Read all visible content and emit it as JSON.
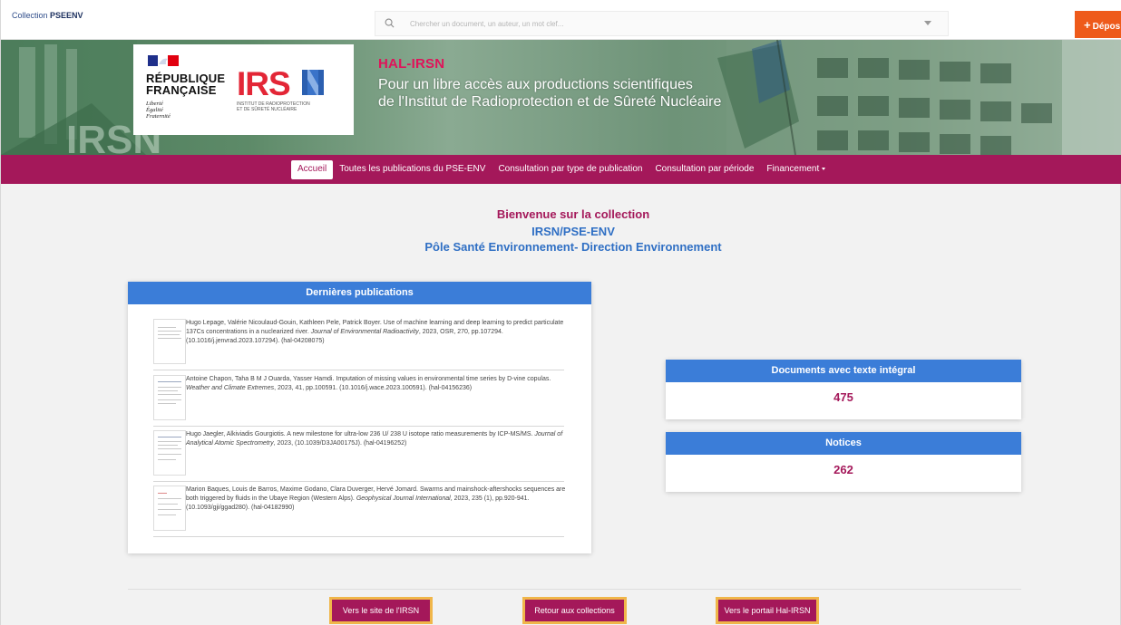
{
  "topbar": {
    "collection_prefix": "Collection",
    "collection_code": "PSEENV",
    "search_placeholder": "Chercher un document, un auteur, un mot clef...",
    "deposit_label": "Dépos"
  },
  "banner": {
    "republique_l1": "RÉPUBLIQUE",
    "republique_l2": "FRANÇAISE",
    "motto": "Liberté\nÉgalité\nFraternité",
    "irsn_logo": "IRSN",
    "irsn_subtitle": "INSTITUT DE RADIOPROTECTION\nET DE SÛRETÉ NUCLÉAIRE",
    "brand": "HAL-IRSN",
    "tagline_l1": "Pour un libre accès aux productions scientifiques",
    "tagline_l2": "de l'Institut de Radioprotection et de Sûreté Nucléaire"
  },
  "nav": {
    "items": [
      {
        "label": "Accueil",
        "active": true
      },
      {
        "label": "Toutes les publications du PSE-ENV"
      },
      {
        "label": "Consultation par type de publication"
      },
      {
        "label": "Consultation par période"
      },
      {
        "label": "Financement"
      }
    ]
  },
  "welcome": {
    "line1": "Bienvenue sur la collection",
    "line2": "IRSN/PSE-ENV",
    "line3": "Pôle Santé Environnement- Direction Environnement"
  },
  "publications": {
    "title": "Dernières publications",
    "items": [
      {
        "authors": "Hugo Lepage, Valérie Nicoulaud-Gouin, Kathleen Pele, Patrick Boyer.",
        "title": " Use of machine learning and deep learning to predict particulate 137Cs concentrations in a nuclearized river. ",
        "journal": "Journal of Environmental Radioactivity",
        "details": ", 2023, OSR, 270, pp.107294. (10.1016/j.jenvrad.2023.107294). (hal-04208075)"
      },
      {
        "authors": "Antoine Chapon, Taha B M J Ouarda, Yasser Hamdi.",
        "title": " Imputation of missing values in environmental time series by D-vine copulas. ",
        "journal": "Weather and Climate Extremes",
        "details": ", 2023, 41, pp.100591. (10.1016/j.wace.2023.100591). (hal-04156236)"
      },
      {
        "authors": "Hugo Jaegler, Alkiviadis Gourgiotis.",
        "title": " A new milestone for ultra-low 236 U/ 238 U isotope ratio measurements by ICP-MS/MS. ",
        "journal": "Journal of Analytical Atomic Spectrometry",
        "details": ", 2023, (10.1039/D3JA00175J). (hal-04196252)"
      },
      {
        "authors": "Marion Baques, Louis de Barros, Maxime Godano, Clara Duverger, Hervé Jomard.",
        "title": " Swarms and mainshock-aftershocks sequences are both triggered by fluids in the Ubaye Region (Western Alps). ",
        "journal": "Geophysical Journal International",
        "details": ", 2023, 235 (1), pp.920-941. (10.1093/gji/ggad280). (hal-04182990)"
      }
    ]
  },
  "stats": {
    "fulltext_label": "Documents avec texte intégral",
    "fulltext_value": "475",
    "notices_label": "Notices",
    "notices_value": "262"
  },
  "footer": {
    "btn_irsn": "Vers le site de l'IRSN",
    "btn_collections": "Retour aux collections",
    "btn_portal": "Vers le portail Hal-IRSN"
  },
  "colors": {
    "brand_magenta": "#a4185a",
    "panel_blue": "#3b7dd8",
    "deposit_orange": "#ee5a1a"
  }
}
